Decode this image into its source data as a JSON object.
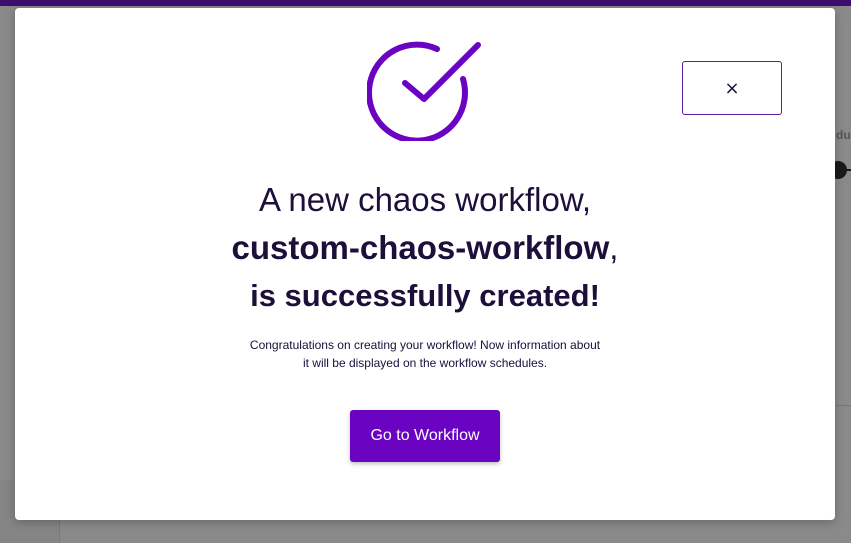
{
  "modal": {
    "close_symbol": "×",
    "icon": "check-circle-icon",
    "headline_prefix": "A new chaos workflow,",
    "workflow_name": "custom-chaos-workflow",
    "workflow_name_suffix": ",",
    "headline_suffix": "is successfully created!",
    "description_line1": "Congratulations on creating your workflow! Now information about",
    "description_line2": "it will be displayed on the workflow schedules.",
    "primary_button_label": "Go to Workflow"
  },
  "background": {
    "right_partial_text": "du"
  },
  "colors": {
    "accent": "#6a04c2",
    "text_dark": "#1c0f3a",
    "top_bar": "#3c0f6e"
  }
}
